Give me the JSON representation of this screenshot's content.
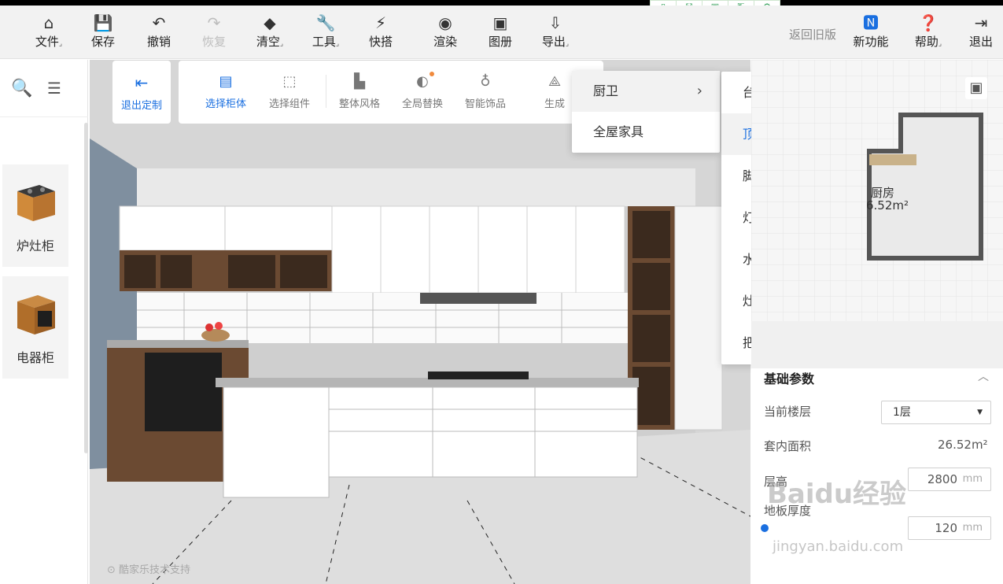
{
  "window": {
    "title": ""
  },
  "mini_toolbar": {
    "icons": [
      "page-icon",
      "expand-icon",
      "save-icon",
      "share-icon",
      "settings-icon"
    ]
  },
  "toolbar": {
    "file": "文件",
    "save": "保存",
    "undo": "撤销",
    "redo": "恢复",
    "clear": "清空",
    "tools": "工具",
    "quick": "快搭",
    "render": "渲染",
    "album": "图册",
    "export": "导出",
    "old_version": "返回旧版",
    "new_feature": "新功能",
    "help": "帮助",
    "logout": "退出"
  },
  "left_panel": {
    "items": [
      {
        "label": "炉灶柜"
      },
      {
        "label": "电器柜"
      }
    ]
  },
  "sub_toolbar": {
    "exit_custom": "退出定制",
    "select_cabinet": "选择柜体",
    "select_component": "选择组件",
    "overall_style": "整体风格",
    "global_replace": "全局替换",
    "smart_decor": "智能饰品",
    "generate": "生成"
  },
  "dropdown": {
    "level1": [
      {
        "label": "厨卫"
      },
      {
        "label": "全屋家具"
      }
    ],
    "level2": [
      {
        "label": "台面"
      },
      {
        "label": "顶线"
      },
      {
        "label": "脚线"
      },
      {
        "label": "灯线"
      },
      {
        "label": "水槽"
      },
      {
        "label": "灶台"
      },
      {
        "label": "把手"
      }
    ],
    "selected": "顶线"
  },
  "floorplan": {
    "room_name": "厨房",
    "area_label": "6.52m²"
  },
  "properties": {
    "title": "基础参数",
    "floor_label": "当前楼层",
    "floor_value": "1层",
    "area_label": "套内面积",
    "area_value": "26.52m²",
    "height_label": "层高",
    "height_value": "2800",
    "height_unit": "mm",
    "thickness_label": "地板厚度",
    "thickness_value": "120",
    "thickness_unit": "mm"
  },
  "watermark": {
    "line1": "Baidu经验",
    "line2": "jingyan.baidu.com"
  },
  "credit": "酷家乐技术支持",
  "colors": {
    "accent": "#1a6fe0",
    "toolbar_bg": "#f2f2f2",
    "cabinet_wood": "#6b4a32"
  }
}
